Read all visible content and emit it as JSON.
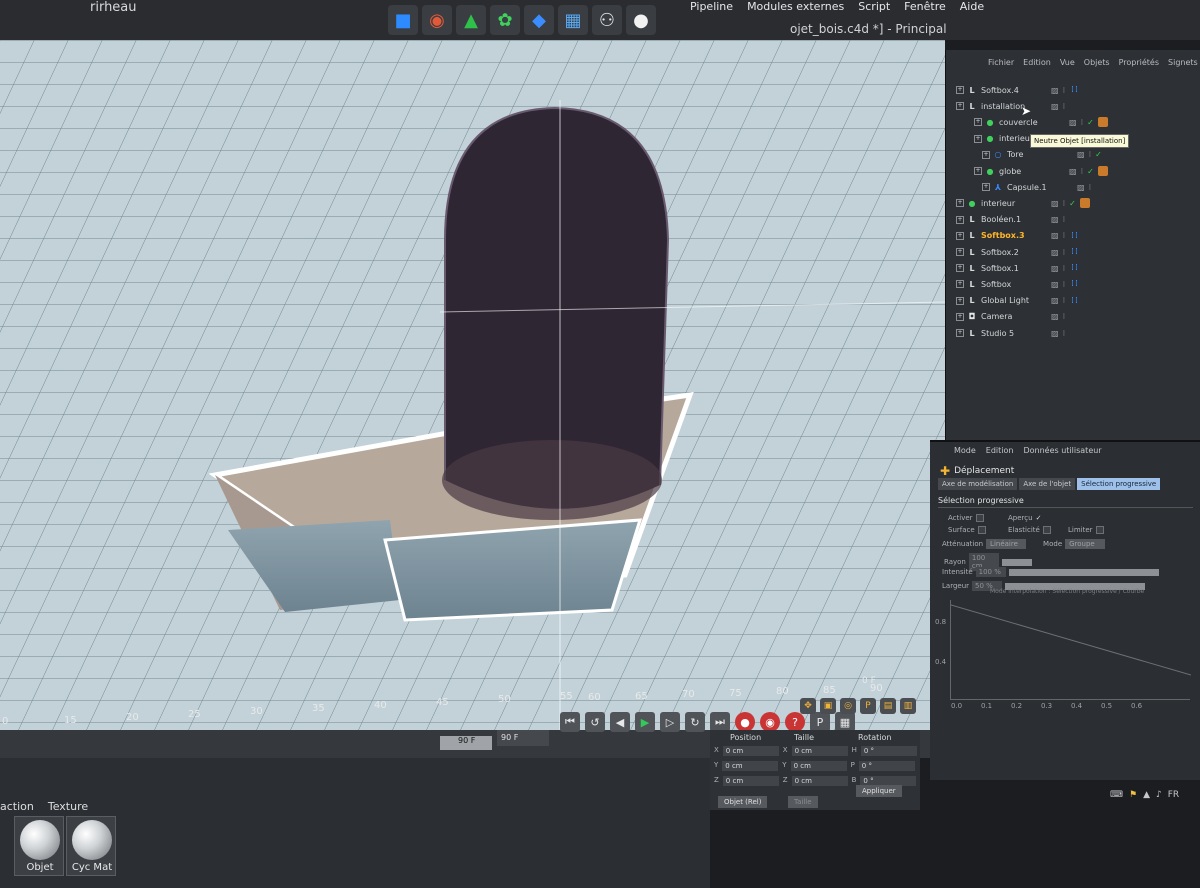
{
  "document": {
    "left_fragment": "rirheau",
    "title": "ojet_bois.c4d *] - Principal"
  },
  "main_menu": [
    "Pipeline",
    "Modules externes",
    "Script",
    "Fenêtre",
    "Aide"
  ],
  "toolbar_icons": [
    "cube-icon",
    "spline-icon",
    "generator-icon",
    "array-icon",
    "deformer-icon",
    "floor-icon",
    "camera-icon",
    "light-icon"
  ],
  "object_manager": {
    "menu": [
      "Fichier",
      "Edition",
      "Vue",
      "Objets",
      "Propriétés",
      "Signets"
    ],
    "tooltip": "Neutre Objet [installation]",
    "objects": [
      {
        "label": "Softbox.4",
        "kind": "null",
        "highlight": false,
        "checked": false,
        "dots": true
      },
      {
        "label": "installation",
        "kind": "null",
        "highlight": false,
        "checked": false,
        "dots": false
      },
      {
        "label": "couvercle",
        "kind": "green",
        "highlight": false,
        "checked": true,
        "dots": false
      },
      {
        "label": "interieur",
        "kind": "green",
        "highlight": false,
        "checked": true,
        "dots": false
      },
      {
        "label": "Tore",
        "kind": "torus",
        "highlight": false,
        "checked": true,
        "dots": false
      },
      {
        "label": "globe",
        "kind": "green",
        "highlight": false,
        "checked": true,
        "dots": false
      },
      {
        "label": "Capsule.1",
        "kind": "capsule",
        "highlight": false,
        "checked": false,
        "dots": false
      },
      {
        "label": "interieur",
        "kind": "green",
        "highlight": false,
        "checked": true,
        "dots": false
      },
      {
        "label": "Booléen.1",
        "kind": "null",
        "highlight": false,
        "checked": false,
        "dots": false
      },
      {
        "label": "Softbox.3",
        "kind": "null",
        "highlight": true,
        "checked": false,
        "dots": true
      },
      {
        "label": "Softbox.2",
        "kind": "null",
        "highlight": false,
        "checked": false,
        "dots": true
      },
      {
        "label": "Softbox.1",
        "kind": "null",
        "highlight": false,
        "checked": false,
        "dots": true
      },
      {
        "label": "Softbox",
        "kind": "null",
        "highlight": false,
        "checked": false,
        "dots": true
      },
      {
        "label": "Global Light",
        "kind": "null",
        "highlight": false,
        "checked": false,
        "dots": true
      },
      {
        "label": "Camera",
        "kind": "camera",
        "highlight": false,
        "checked": false,
        "dots": false
      },
      {
        "label": "Studio 5",
        "kind": "null",
        "highlight": false,
        "checked": false,
        "dots": false
      }
    ]
  },
  "attribute_manager": {
    "menu": [
      "Mode",
      "Edition",
      "Données utilisateur"
    ],
    "tool": "Déplacement",
    "tabs": [
      "Axe de modélisation",
      "Axe de l'objet",
      "Sélection progressive"
    ],
    "active_tab": "Sélection progressive",
    "section": "Sélection progressive",
    "activer": "Activer",
    "apercu": "Aperçu",
    "surface": "Surface",
    "elasticite": "Elasticité",
    "limiter": "Limiter",
    "attenuation_label": "Atténuation",
    "attenuation_value": "Linéaire",
    "mode_label": "Mode",
    "mode_value": "Groupe",
    "rayon_label": "Rayon",
    "rayon_value": "100 cm",
    "intensite_label": "Intensité",
    "intensite_value": "100 %",
    "largeur_label": "Largeur",
    "largeur_value": "50 %",
    "graph_caption": "Mode interpolation : Sélection progressive / Courbe",
    "graph_y_ticks": [
      "0.8",
      "0.4"
    ],
    "graph_x_ticks": [
      "0.0",
      "0.1",
      "0.2",
      "0.3",
      "0.4",
      "0.5",
      "0.6"
    ]
  },
  "timeline": {
    "ruler_low": [
      "0",
      "15",
      "20",
      "25",
      "30",
      "35",
      "40",
      "45",
      "50",
      "55"
    ],
    "ruler_high": [
      "60",
      "65",
      "70",
      "75",
      "80",
      "85",
      "90"
    ],
    "end_label": "0 F",
    "frame_a": "90 F",
    "frame_b": "90 F"
  },
  "coordinates": {
    "headers": [
      "Position",
      "Taille",
      "Rotation"
    ],
    "rows": [
      {
        "axis": "X",
        "pos": "0 cm",
        "size_axis": "X",
        "size": "0 cm",
        "rot_axis": "H",
        "rot": "0 °"
      },
      {
        "axis": "Y",
        "pos": "0 cm",
        "size_axis": "Y",
        "size": "0 cm",
        "rot_axis": "P",
        "rot": "0 °"
      },
      {
        "axis": "Z",
        "pos": "0 cm",
        "size_axis": "Z",
        "size": "0 cm",
        "rot_axis": "B",
        "rot": "0 °"
      }
    ],
    "mode": "Objet (Rel)",
    "size_mode": "Taille",
    "apply": "Appliquer"
  },
  "materials": {
    "menu": [
      "action",
      "Texture"
    ],
    "items": [
      "Objet",
      "Cyc Mat"
    ]
  },
  "tray": [
    "FR"
  ],
  "colors": {
    "viewport_bg": "#c2d2d8",
    "panel_bg": "#2d3034",
    "accent_orange": "#ffb728",
    "active_tab": "#9fc0e8"
  }
}
